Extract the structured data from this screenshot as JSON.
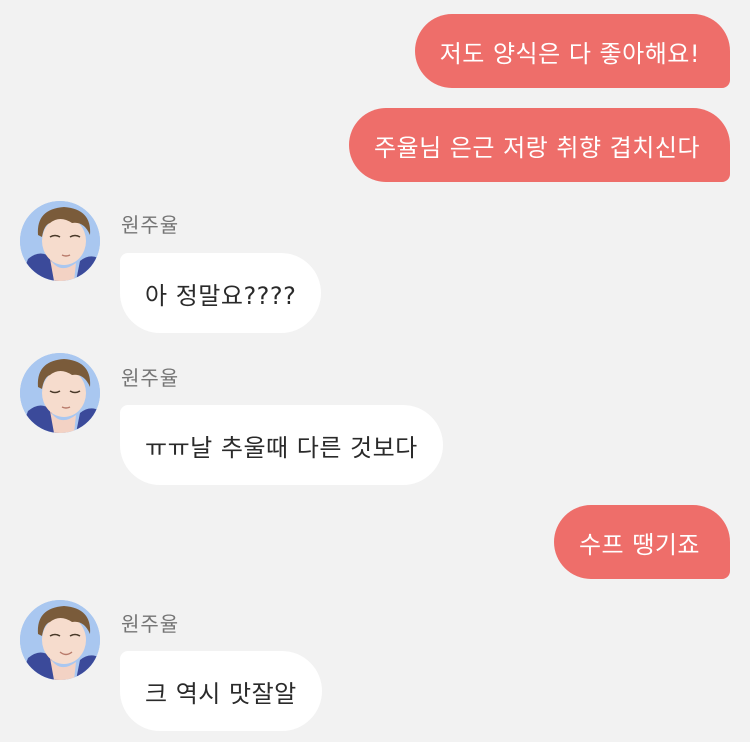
{
  "messages": [
    {
      "side": "out",
      "text": "저도 양식은 다 좋아해요!"
    },
    {
      "side": "out",
      "text": "주율님 은근 저랑 취향 겹치신다"
    },
    {
      "side": "in",
      "sender": "원주율",
      "text": "아 정말요????"
    },
    {
      "side": "in",
      "sender": "원주율",
      "text": "ㅠㅠ날 추울때 다른 것보다"
    },
    {
      "side": "out",
      "text": "수프 땡기죠"
    },
    {
      "side": "in",
      "sender": "원주율",
      "text": "크 역시 맛잘알"
    }
  ],
  "colors": {
    "background": "#f2f2f2",
    "outgoing_bubble": "#ee6e6a",
    "incoming_bubble": "#ffffff"
  }
}
